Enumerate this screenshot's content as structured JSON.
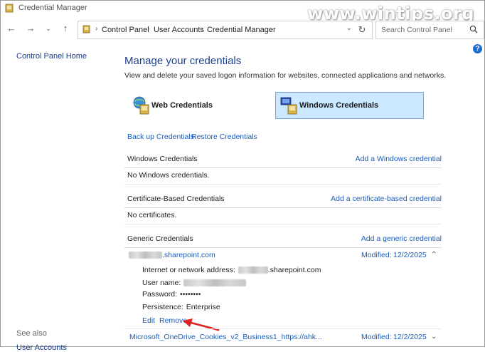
{
  "window": {
    "title": "Credential Manager",
    "watermark": "www.wintips.org"
  },
  "nav": {
    "back_icon": "arrow-left-icon",
    "forward_icon": "arrow-right-icon",
    "recent_icon": "chevron-down-icon",
    "up_icon": "arrow-up-icon",
    "breadcrumbs": [
      "Control Panel",
      "User Accounts",
      "Credential Manager"
    ],
    "search_placeholder": "Search Control Panel"
  },
  "left_pane": {
    "home_link": "Control Panel Home",
    "see_also": "See also",
    "user_accounts": "User Accounts"
  },
  "main": {
    "heading": "Manage your credentials",
    "subheading": "View and delete your saved logon information for websites, connected applications and networks.",
    "tiles": {
      "web": "Web Credentials",
      "windows": "Windows Credentials"
    },
    "backup_link": "Back up Credentials",
    "restore_link": "Restore Credentials"
  },
  "sections": {
    "windows": {
      "title": "Windows Credentials",
      "add": "Add a Windows credential",
      "empty": "No Windows credentials."
    },
    "certificate": {
      "title": "Certificate-Based Credentials",
      "add": "Add a certificate-based credential",
      "empty": "No certificates."
    },
    "generic": {
      "title": "Generic Credentials",
      "add": "Add a generic credential",
      "items": [
        {
          "name_suffix": ".sharepoint.com",
          "modified_label": "Modified:",
          "modified_date": "12/2/2025",
          "address_label": "Internet or network address:",
          "address_suffix": ".sharepoint.com",
          "username_label": "User name:",
          "password_label": "Password:",
          "password_value": "••••••••",
          "persistence_label": "Persistence:",
          "persistence_value": "Enterprise",
          "edit": "Edit",
          "remove": "Remove"
        },
        {
          "name": "Microsoft_OneDrive_Cookies_v2_Business1_https://ahk...",
          "modified_label": "Modified:",
          "modified_date": "12/2/2025"
        }
      ]
    }
  },
  "colors": {
    "link": "#1a5ebb",
    "heading": "#1d3f8f",
    "selected_tile": "#cce8ff",
    "arrow": "#e02020"
  }
}
